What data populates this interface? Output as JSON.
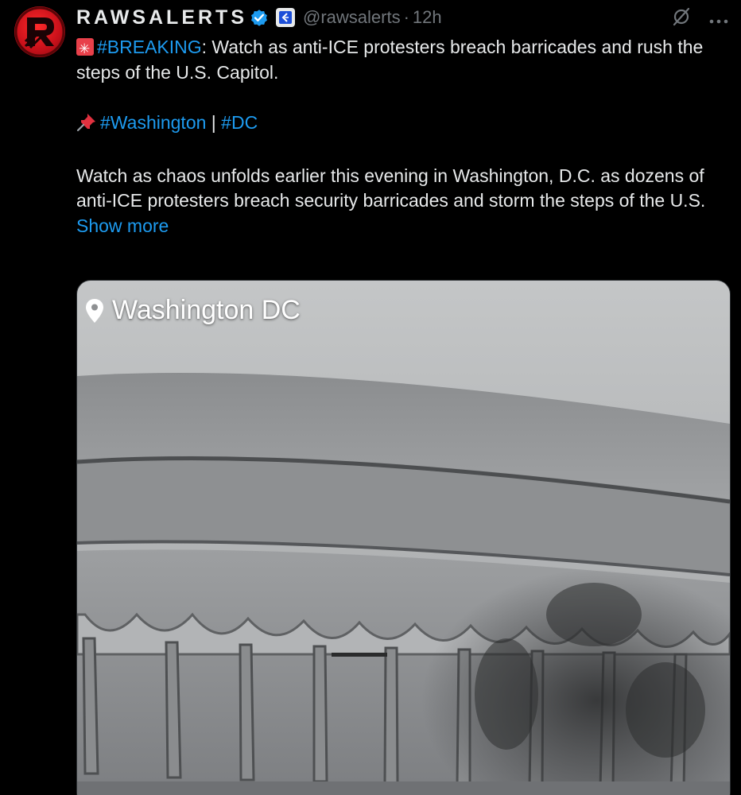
{
  "author": {
    "display_name": "RAWSALERTS",
    "handle": "@rawsalerts",
    "separator": "·",
    "time": "12h"
  },
  "post": {
    "line1_tag": "#BREAKING",
    "line1_rest": ": Watch as anti-ICE protesters breach barricades and rush the steps of the U.S. Capitol.",
    "hashtag_1": "#Washington",
    "hashtag_sep": " | ",
    "hashtag_2": "#DC",
    "body": "Watch as chaos unfolds earlier this evening in Washington, D.C. as dozens of anti-ICE protesters breach security barricades and storm the steps of the U.S.",
    "show_more": "Show more"
  },
  "media": {
    "location_label": "Washington DC"
  },
  "icons": {
    "avatar": "rawsalerts-logo",
    "verified": "verified-badge-icon",
    "affiliate": "affiliate-badge-icon",
    "grok": "grok-icon",
    "more": "more-dots-icon",
    "siren": "rotating-light-icon",
    "pin": "pushpin-icon",
    "location": "location-pin-icon"
  },
  "colors": {
    "background": "#000000",
    "text": "#e7e9ea",
    "secondary": "#71767b",
    "link": "#1d9bf0",
    "avatar_red": "#c8101a"
  }
}
